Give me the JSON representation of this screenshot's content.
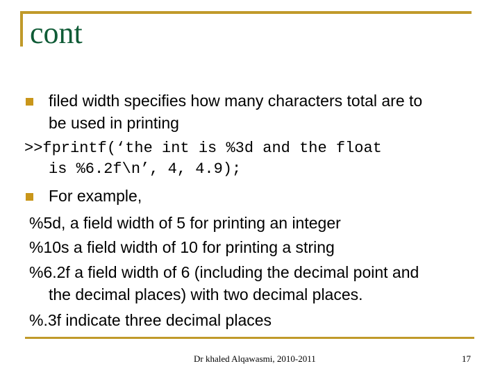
{
  "theme": {
    "accent": "#c09a2a",
    "title_color": "#0f5b36",
    "bullet_color": "#c9961a"
  },
  "slide": {
    "title": "cont",
    "body": {
      "bullet_1": {
        "icon": "square-bullet-icon",
        "line_1": "filed width specifies how many characters total are to",
        "line_2": "be used in printing"
      },
      "code": {
        "line_1": ">>fprintf(‘the int is %3d and the float",
        "line_2": "is %6.2f\\n’, 4, 4.9);"
      },
      "bullet_2": {
        "icon": "square-bullet-icon",
        "text": "For example,"
      },
      "examples": [
        "%5d, a field width of 5 for printing an integer",
        "%10s a field width of 10 for printing a string",
        "%6.2f a field width of 6 (including the decimal point and",
        "the decimal places) with two decimal places.",
        "%.3f indicate three decimal places"
      ]
    },
    "footer": {
      "author": "Dr khaled Alqawasmi, 2010-2011",
      "page_number": "17"
    }
  }
}
